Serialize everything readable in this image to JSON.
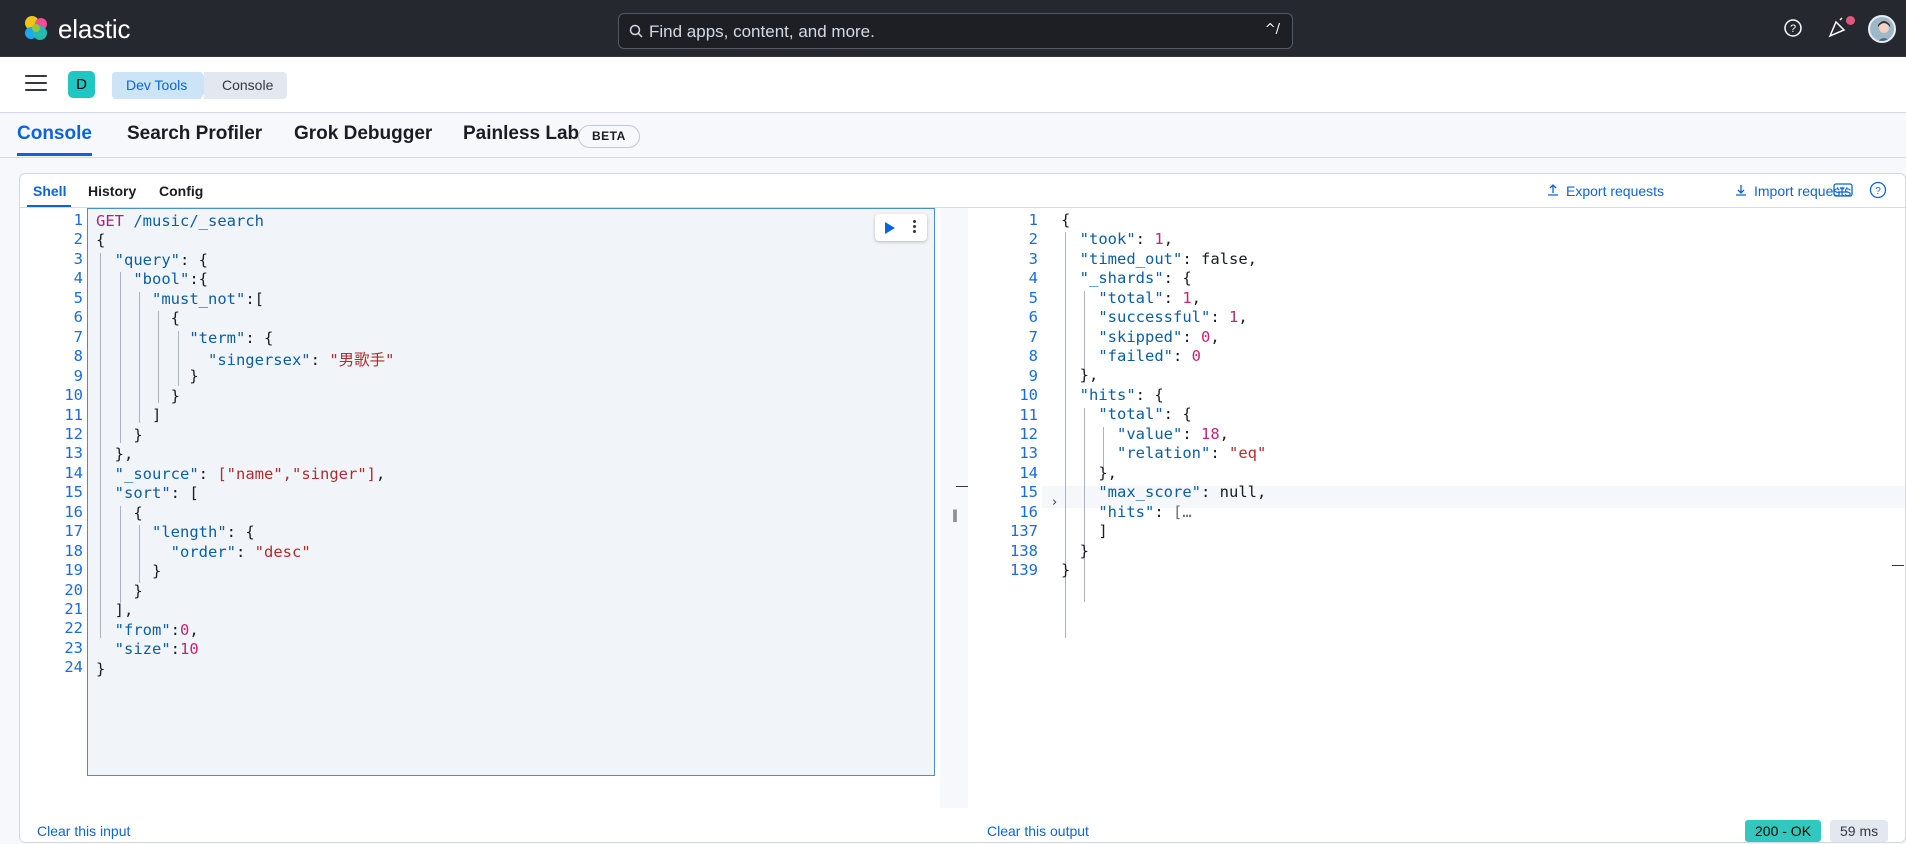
{
  "header": {
    "logo_text": "elastic",
    "search_placeholder": "Find apps, content, and more.",
    "search_shortcut": "^/",
    "icons": [
      "help-icon",
      "news-icon",
      "user-avatar"
    ]
  },
  "subheader": {
    "space_badge": "D",
    "breadcrumbs": [
      "Dev Tools",
      "Console"
    ]
  },
  "app_tabs": {
    "items": [
      "Console",
      "Search Profiler",
      "Grok Debugger",
      "Painless Lab"
    ],
    "beta_label": "BETA",
    "active": "Console"
  },
  "console": {
    "shell_tabs": [
      "Shell",
      "History",
      "Config"
    ],
    "export_label": "Export requests",
    "import_label": "Import requests",
    "request_lines": [
      "1",
      "2",
      "3",
      "4",
      "5",
      "6",
      "7",
      "8",
      "9",
      "10",
      "11",
      "12",
      "13",
      "14",
      "15",
      "16",
      "17",
      "18",
      "19",
      "20",
      "21",
      "22",
      "23",
      "24"
    ],
    "response_lines": [
      "1",
      "2",
      "3",
      "4",
      "5",
      "6",
      "7",
      "8",
      "9",
      "10",
      "11",
      "12",
      "13",
      "14",
      "15",
      "16",
      "137",
      "138",
      "139"
    ],
    "clear_input_label": "Clear this input",
    "clear_output_label": "Clear this output",
    "status_label": "200 - OK",
    "time_label": "59 ms"
  },
  "request": {
    "method": "GET",
    "path": " /music/_search",
    "singersex_value": "\"男歌手\"",
    "source_fields": "[\"name\",\"singer\"]",
    "sort_order": "\"desc\"",
    "from": "0",
    "size": "10"
  },
  "response": {
    "took": "1",
    "timed_out": "false",
    "shards_total": "1",
    "shards_successful": "1",
    "shards_skipped": "0",
    "shards_failed": "0",
    "hits_total_value": "18",
    "hits_total_relation": "\"eq\"",
    "max_score": "null",
    "hits_collapsed": "[…"
  },
  "colors": {
    "accent": "#0b64dd",
    "ok_badge": "#32c8c0",
    "space_badge": "#1ec7c3"
  }
}
